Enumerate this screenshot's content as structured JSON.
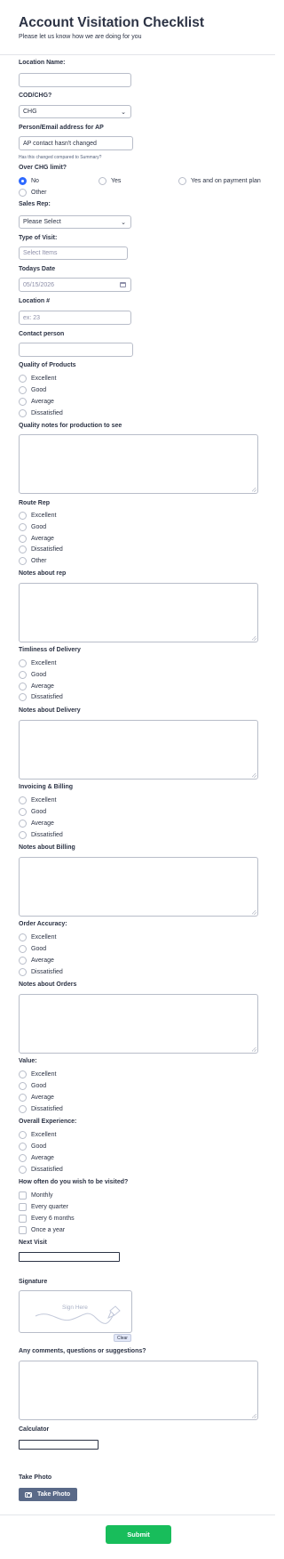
{
  "header": {
    "title": "Account Visitation Checklist",
    "subtitle": "Please let us know how we are doing for you"
  },
  "location_name": {
    "label": "Location Name:",
    "value": ""
  },
  "cod_chg": {
    "label": "COD/CHG?",
    "value": "CHG"
  },
  "person_email": {
    "label": "Person/Email address for AP",
    "value": "AP contact hasn't changed",
    "help": "Has this changed compared to Summary?"
  },
  "over_chg": {
    "label": "Over CHG limit?",
    "options": [
      "No",
      "Yes",
      "Yes and on payment plan",
      "Other"
    ],
    "selected": "No"
  },
  "sales_rep": {
    "label": "Sales Rep:",
    "value": "Please Select"
  },
  "type_of_visit": {
    "label": "Type of Visit:",
    "placeholder": "Select Items"
  },
  "todays_date": {
    "label": "Todays Date",
    "placeholder": "05/15/2026"
  },
  "location_num": {
    "label": "Location #",
    "placeholder": "ex: 23"
  },
  "contact_person": {
    "label": "Contact person",
    "value": ""
  },
  "quality_products": {
    "label": "Quality of Products",
    "options": [
      "Excellent",
      "Good",
      "Average",
      "Dissatisfied"
    ]
  },
  "quality_notes": {
    "label": "Quality notes for production to see"
  },
  "route_rep": {
    "label": "Route Rep",
    "options": [
      "Excellent",
      "Good",
      "Average",
      "Dissatisfied",
      "Other"
    ]
  },
  "notes_rep": {
    "label": "Notes about rep"
  },
  "timeliness": {
    "label": "Timliness of Delivery",
    "options": [
      "Excellent",
      "Good",
      "Average",
      "Dissatisfied"
    ]
  },
  "notes_delivery": {
    "label": "Notes about Delivery"
  },
  "invoicing": {
    "label": "Invoicing & Billing",
    "options": [
      "Excellent",
      "Good",
      "Average",
      "Dissatisfied"
    ]
  },
  "notes_billing": {
    "label": "Notes about Billing"
  },
  "order_accuracy": {
    "label": "Order Accuracy:",
    "options": [
      "Excellent",
      "Good",
      "Average",
      "Dissatisfied"
    ]
  },
  "notes_orders": {
    "label": "Notes about Orders"
  },
  "value": {
    "label": "Value:",
    "options": [
      "Excellent",
      "Good",
      "Average",
      "Dissatisfied"
    ]
  },
  "overall": {
    "label": "Overall Experience:",
    "options": [
      "Excellent",
      "Good",
      "Average",
      "Dissatisfied"
    ]
  },
  "visit_freq": {
    "label": "How often do you wish to be visited?",
    "options": [
      "Monthly",
      "Every quarter",
      "Every 6 months",
      "Once a year"
    ]
  },
  "next_visit": {
    "label": "Next Visit",
    "value": ""
  },
  "signature": {
    "label": "Signature",
    "placeholder": "Sign Here",
    "clear_label": "Clear"
  },
  "comments": {
    "label": "Any comments, questions or suggestions?"
  },
  "calculator": {
    "label": "Calculator",
    "value": ""
  },
  "take_photo": {
    "label": "Take Photo",
    "button_label": "Take Photo"
  },
  "submit": {
    "label": "Submit"
  },
  "colors": {
    "accent": "#2e69ff",
    "submit": "#18bd5b",
    "photo_button": "#5a6a88",
    "text": "#2c3345",
    "border": "#b8bdc9"
  }
}
